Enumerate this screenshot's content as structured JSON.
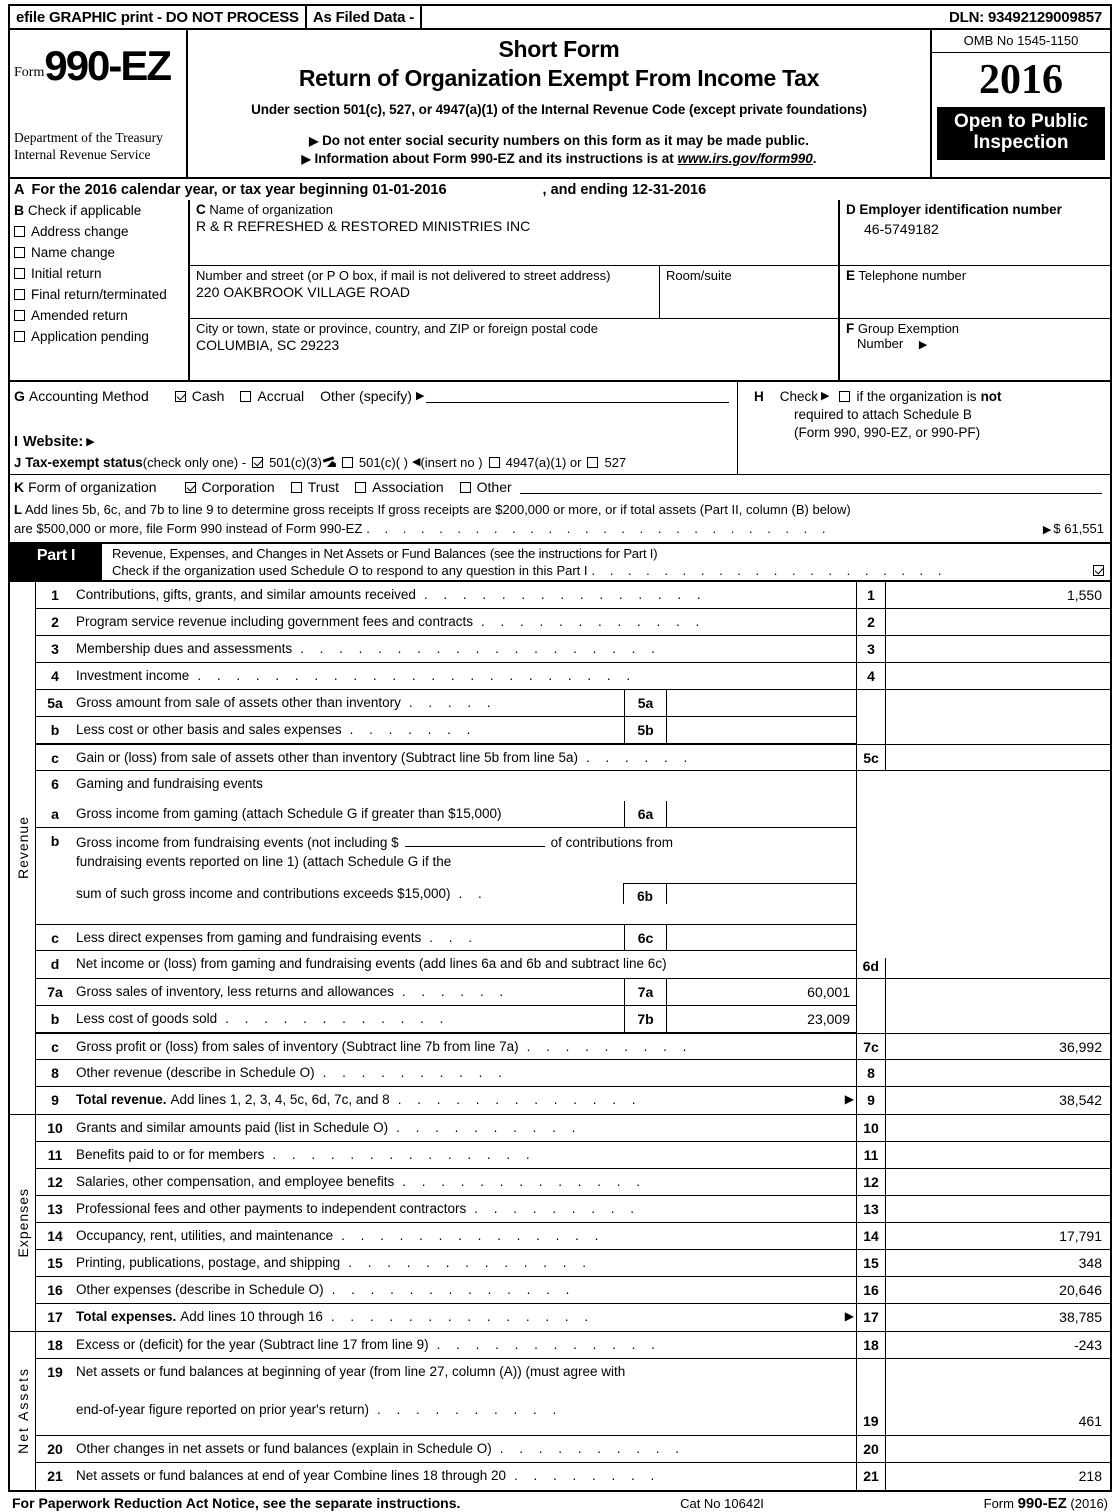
{
  "efile": {
    "graphic_print": "efile GRAPHIC print - DO NOT PROCESS",
    "as_filed": "As Filed Data -",
    "dln": "DLN: 93492129009857"
  },
  "header": {
    "form_word": "Form",
    "form_number": "990-EZ",
    "department_line1": "Department of the Treasury",
    "department_line2": "Internal Revenue Service",
    "title_short": "Short Form",
    "title_main": "Return of Organization Exempt From Income Tax",
    "subtitle": "Under section 501(c), 527, or 4947(a)(1) of the Internal Revenue Code (except private foundations)",
    "bullet1": "Do not enter social security numbers on this form as it may be made public.",
    "bullet2_pre": "Information about Form 990-EZ and its instructions is at",
    "bullet2_link": "www.irs.gov/form990",
    "bullet2_post": ".",
    "omb": "OMB No  1545-1150",
    "year": "2016",
    "open_to_public_l1": "Open to Public",
    "open_to_public_l2": "Inspection"
  },
  "line_a": {
    "letter": "A",
    "text": "For the 2016 calendar year, or tax year beginning 01-01-2016",
    "ending": ", and ending 12-31-2016"
  },
  "block_b": {
    "letter": "B",
    "heading": "Check if applicable",
    "items": [
      {
        "label": "Address change",
        "checked": false
      },
      {
        "label": "Name change",
        "checked": false
      },
      {
        "label": "Initial return",
        "checked": false
      },
      {
        "label": "Final return/terminated",
        "checked": false
      },
      {
        "label": "Amended return",
        "checked": false
      },
      {
        "label": "Application pending",
        "checked": false
      }
    ]
  },
  "block_c": {
    "letter": "C",
    "name_caption": "Name of organization",
    "name_value": "R & R REFRESHED & RESTORED MINISTRIES INC",
    "street_caption": "Number and street (or P  O  box, if mail is not delivered to street address)",
    "street_value": "220 OAKBROOK VILLAGE ROAD",
    "room_caption": "Room/suite",
    "room_value": "",
    "city_caption": "City or town, state or province, country, and ZIP or foreign postal code",
    "city_value": "COLUMBIA, SC  29223"
  },
  "block_d": {
    "letter_d": "D",
    "ein_caption": "Employer identification number",
    "ein_value": "46-5749182",
    "letter_e": "E",
    "phone_caption": "Telephone number",
    "phone_value": "",
    "letter_f": "F",
    "group_caption_l1": "Group Exemption",
    "group_caption_l2": "Number",
    "group_value": ""
  },
  "line_g": {
    "letter": "G",
    "label": "Accounting Method",
    "cash": "Cash",
    "cash_checked": true,
    "accrual": "Accrual",
    "accrual_checked": false,
    "other": "Other (specify)"
  },
  "line_h": {
    "letter": "H",
    "check_label": "Check",
    "text_pre": "if the organization is",
    "text_bold": "not",
    "line2": "required to attach Schedule B",
    "line3": "(Form 990, 990-EZ, or 990-PF)"
  },
  "line_i": {
    "letter": "I",
    "label": "Website:",
    "value": ""
  },
  "line_j": {
    "letter": "J",
    "label": "Tax-exempt status",
    "note": "(check only one) -",
    "opt1": "501(c)(3)",
    "opt1_checked": true,
    "opt2": "501(c)(  )",
    "opt2_checked": false,
    "insert_no": "(insert no )",
    "opt3": "4947(a)(1) or",
    "opt3_checked": false,
    "opt4": "527",
    "opt4_checked": false
  },
  "line_k": {
    "letter": "K",
    "label": "Form of organization",
    "options": [
      {
        "label": "Corporation",
        "checked": true
      },
      {
        "label": "Trust",
        "checked": false
      },
      {
        "label": "Association",
        "checked": false
      },
      {
        "label": "Other",
        "checked": false
      }
    ]
  },
  "line_l": {
    "letter": "L",
    "text1": "Add lines 5b, 6c, and 7b to line 9 to determine gross receipts  If gross receipts are $200,000 or more, or if total assets (Part II, column (B) below)",
    "text2": "are $500,000 or more, file Form 990 instead of Form 990-EZ",
    "amount": "$ 61,551"
  },
  "part1": {
    "tag": "Part I",
    "title": "Revenue, Expenses, and Changes in Net Assets or Fund Balances",
    "title_note": "(see the instructions for Part I)",
    "check_text": "Check if the organization used Schedule O to respond to any question in this Part I",
    "checked": true
  },
  "sections": {
    "revenue_label": "Revenue",
    "expenses_label": "Expenses",
    "net_assets_label": "Net Assets"
  },
  "rows": {
    "r1": {
      "num": "1",
      "desc": "Contributions, gifts, grants, and similar amounts received",
      "line": "1",
      "amount": "1,550"
    },
    "r2": {
      "num": "2",
      "desc": "Program service revenue including government fees and contracts",
      "line": "2",
      "amount": ""
    },
    "r3": {
      "num": "3",
      "desc": "Membership dues and assessments",
      "line": "3",
      "amount": ""
    },
    "r4": {
      "num": "4",
      "desc": "Investment income",
      "line": "4",
      "amount": ""
    },
    "r5a": {
      "num": "5a",
      "desc": "Gross amount from sale of assets other than inventory",
      "sub": "5a",
      "sub_amount": ""
    },
    "r5b": {
      "num": "b",
      "desc": "Less  cost or other basis and sales expenses",
      "sub": "5b",
      "sub_amount": ""
    },
    "r5c": {
      "num": "c",
      "desc": "Gain or (loss) from sale of assets other than inventory (Subtract line 5b from line 5a)",
      "line": "5c",
      "amount": ""
    },
    "r6": {
      "num": "6",
      "desc": "Gaming and fundraising events"
    },
    "r6a": {
      "num": "a",
      "desc": "Gross income from gaming (attach Schedule G if greater than $15,000)",
      "sub": "6a",
      "sub_amount": ""
    },
    "r6b": {
      "num": "b",
      "desc_l1_pre": "Gross income from fundraising events (not including $",
      "desc_l1_post": "of contributions from",
      "desc_l2": "fundraising events reported on line 1) (attach Schedule G if the",
      "desc_l3": "sum of such gross income and contributions exceeds $15,000)",
      "sub": "6b",
      "sub_amount": ""
    },
    "r6c": {
      "num": "c",
      "desc": "Less  direct expenses from gaming and fundraising events",
      "sub": "6c",
      "sub_amount": ""
    },
    "r6d": {
      "num": "d",
      "desc": "Net income or (loss) from gaming and fundraising events (add lines 6a and 6b and subtract line 6c)",
      "line": "6d",
      "amount": ""
    },
    "r7a": {
      "num": "7a",
      "desc": "Gross sales of inventory, less returns and allowances",
      "sub": "7a",
      "sub_amount": "60,001"
    },
    "r7b": {
      "num": "b",
      "desc": "Less  cost of goods sold",
      "sub": "7b",
      "sub_amount": "23,009"
    },
    "r7c": {
      "num": "c",
      "desc": "Gross profit or (loss) from sales of inventory (Subtract line 7b from line 7a)",
      "line": "7c",
      "amount": "36,992"
    },
    "r8": {
      "num": "8",
      "desc": "Other revenue (describe in Schedule O)",
      "line": "8",
      "amount": ""
    },
    "r9": {
      "num": "9",
      "desc_bold": "Total revenue.",
      "desc": "Add lines 1, 2, 3, 4, 5c, 6d, 7c, and 8",
      "line": "9",
      "amount": "38,542"
    },
    "r10": {
      "num": "10",
      "desc": "Grants and similar amounts paid (list in Schedule O)",
      "line": "10",
      "amount": ""
    },
    "r11": {
      "num": "11",
      "desc": "Benefits paid to or for members",
      "line": "11",
      "amount": ""
    },
    "r12": {
      "num": "12",
      "desc": "Salaries, other compensation, and employee benefits",
      "line": "12",
      "amount": ""
    },
    "r13": {
      "num": "13",
      "desc": "Professional fees and other payments to independent contractors",
      "line": "13",
      "amount": ""
    },
    "r14": {
      "num": "14",
      "desc": "Occupancy, rent, utilities, and maintenance",
      "line": "14",
      "amount": "17,791"
    },
    "r15": {
      "num": "15",
      "desc": "Printing, publications, postage, and shipping",
      "line": "15",
      "amount": "348"
    },
    "r16": {
      "num": "16",
      "desc": "Other expenses (describe in Schedule O)",
      "line": "16",
      "amount": "20,646"
    },
    "r17": {
      "num": "17",
      "desc_bold": "Total expenses.",
      "desc": "Add lines 10 through 16",
      "line": "17",
      "amount": "38,785"
    },
    "r18": {
      "num": "18",
      "desc": "Excess or (deficit) for the year (Subtract line 17 from line 9)",
      "line": "18",
      "amount": "-243"
    },
    "r19": {
      "num": "19",
      "desc_l1": "Net assets or fund balances at beginning of year (from line 27, column (A)) (must agree with",
      "desc_l2": "end-of-year figure reported on prior year's return)",
      "line": "19",
      "amount": "461"
    },
    "r20": {
      "num": "20",
      "desc": "Other changes in net assets or fund balances (explain in Schedule O)",
      "line": "20",
      "amount": ""
    },
    "r21": {
      "num": "21",
      "desc": "Net assets or fund balances at end of year  Combine lines 18 through 20",
      "line": "21",
      "amount": "218"
    }
  },
  "footer": {
    "left": "For Paperwork Reduction Act Notice, see the separate instructions.",
    "cat": "Cat  No  10642I",
    "right_pre": "Form",
    "right_bold": "990-EZ",
    "right_post": "(2016)"
  }
}
